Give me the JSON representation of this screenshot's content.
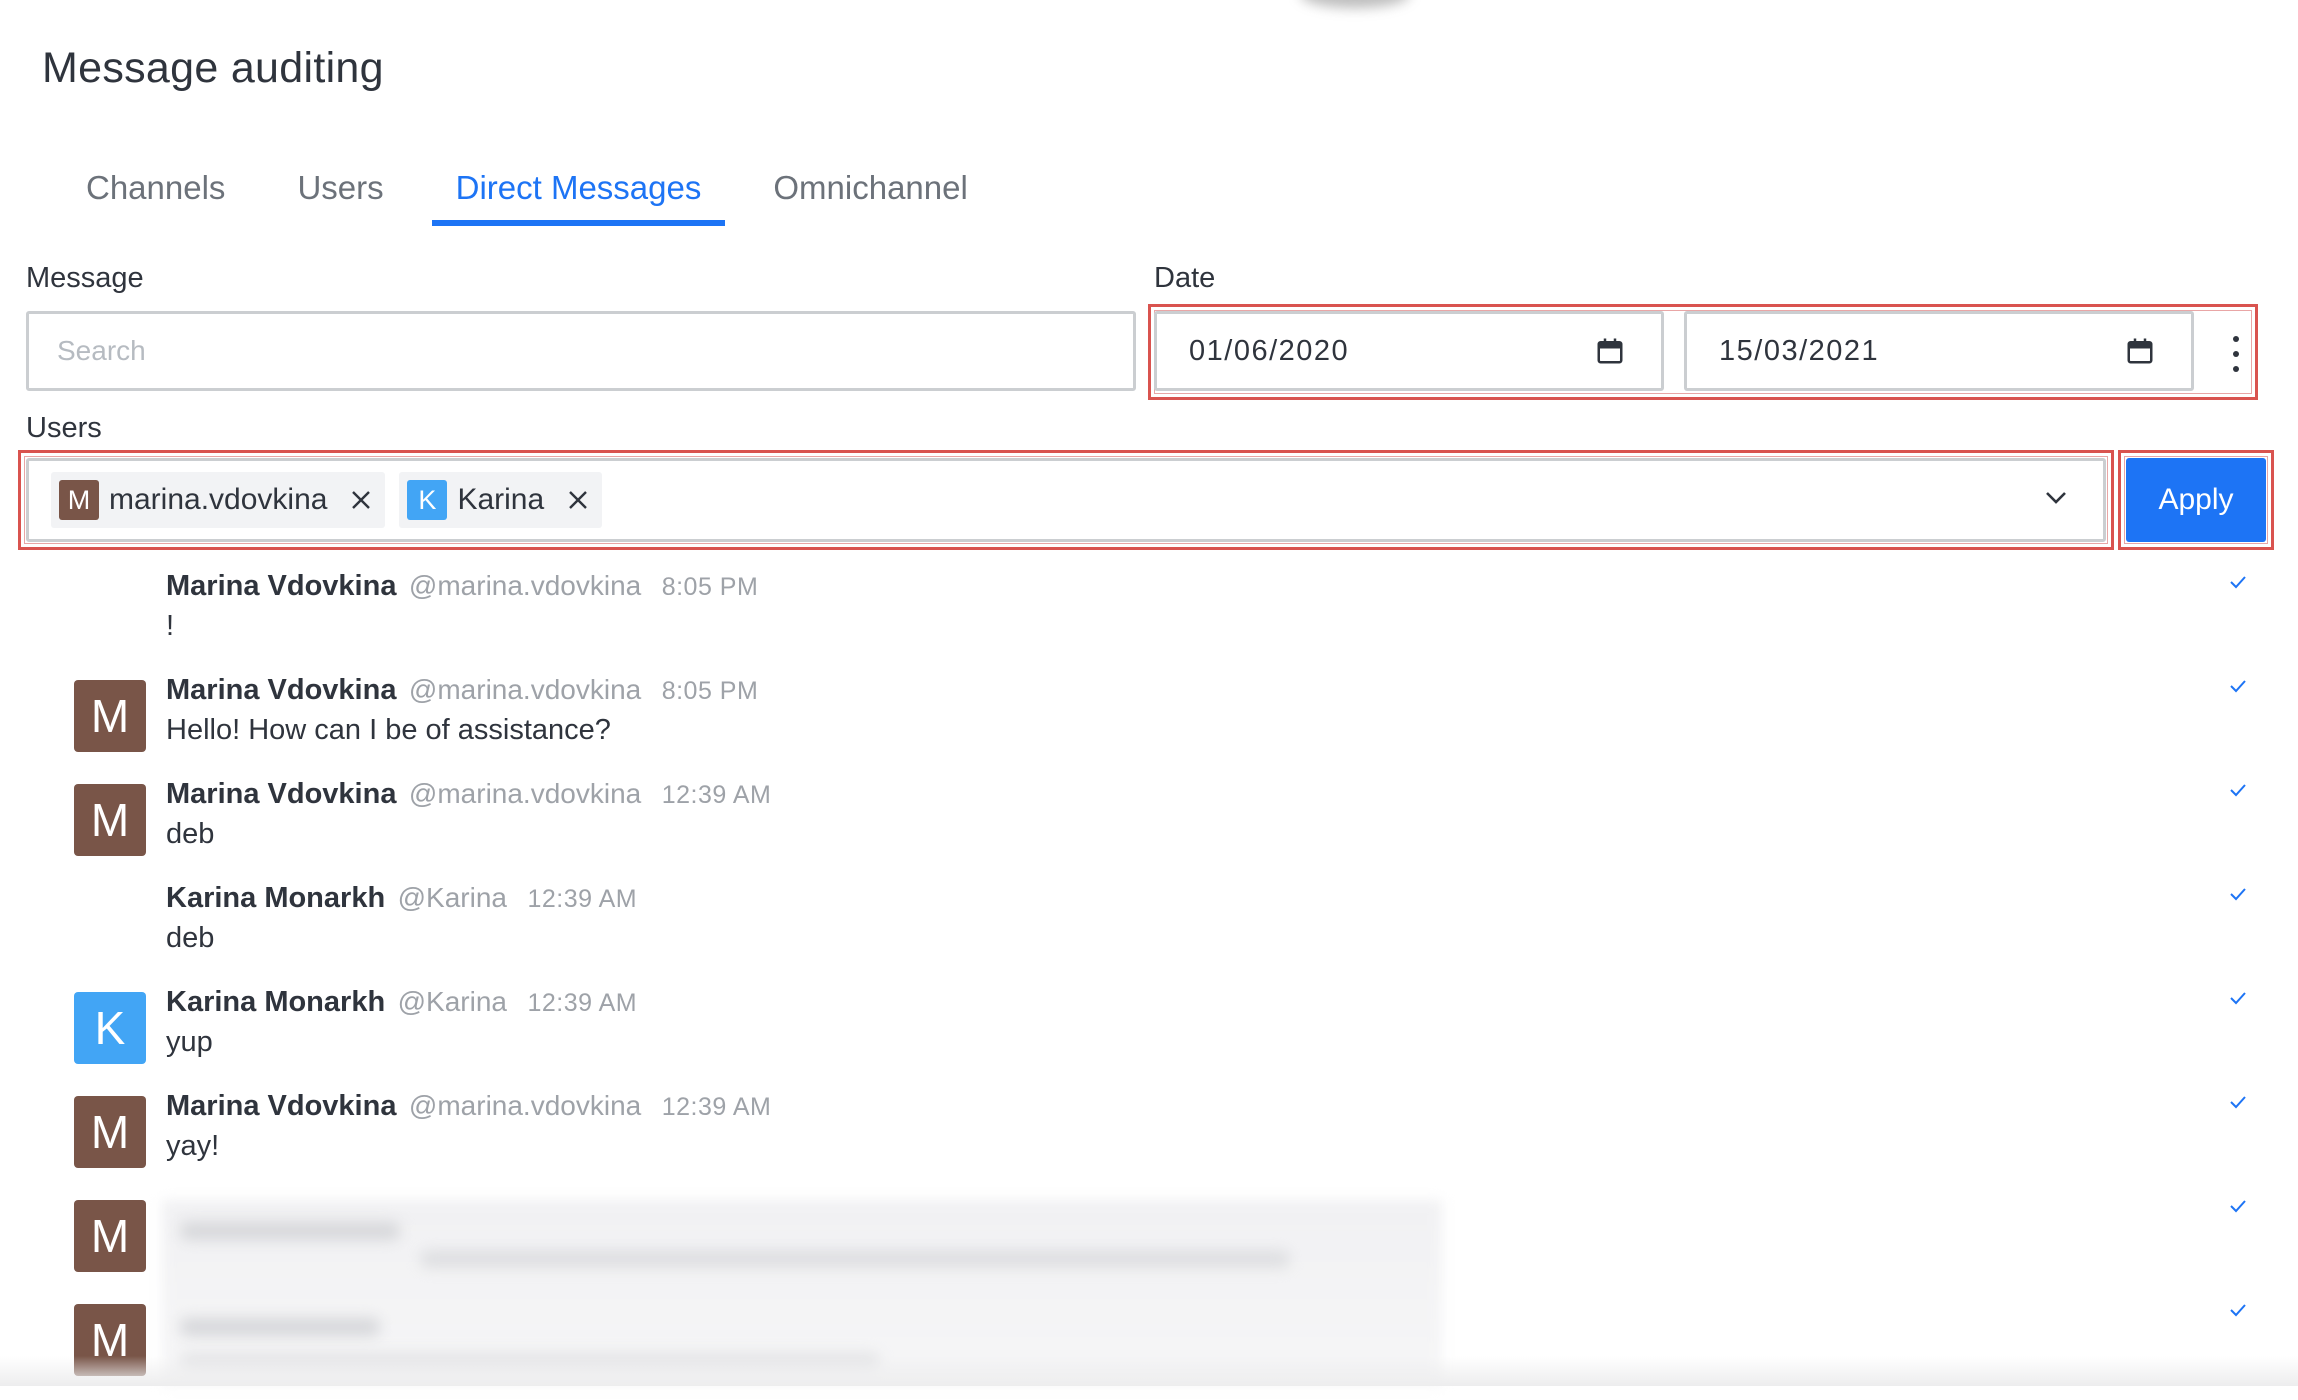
{
  "page": {
    "title": "Message auditing"
  },
  "tabs": [
    {
      "label": "Channels",
      "active": false
    },
    {
      "label": "Users",
      "active": false
    },
    {
      "label": "Direct Messages",
      "active": true
    },
    {
      "label": "Omnichannel",
      "active": false
    }
  ],
  "filters": {
    "message_label": "Message",
    "message_placeholder": "Search",
    "message_value": "",
    "date_label": "Date",
    "date_from": "01/06/2020",
    "date_to": "15/03/2021",
    "users_label": "Users",
    "selected_users": [
      {
        "initial": "M",
        "name": "marina.vdovkina",
        "color": "#795548"
      },
      {
        "initial": "K",
        "name": "Karina",
        "color": "#42a5f5"
      }
    ],
    "apply_label": "Apply"
  },
  "messages": [
    {
      "name": "Marina Vdovkina",
      "username": "@marina.vdovkina",
      "time": "8:05 PM",
      "text": "!",
      "avatar": "",
      "avatar_color": ""
    },
    {
      "name": "Marina Vdovkina",
      "username": "@marina.vdovkina",
      "time": "8:05 PM",
      "text": "Hello! How can I be of assistance?",
      "avatar": "M",
      "avatar_color": "#795548"
    },
    {
      "name": "Marina Vdovkina",
      "username": "@marina.vdovkina",
      "time": "12:39 AM",
      "text": "deb",
      "avatar": "M",
      "avatar_color": "#795548"
    },
    {
      "name": "Karina Monarkh",
      "username": "@Karina",
      "time": "12:39 AM",
      "text": "deb",
      "avatar": "",
      "avatar_color": ""
    },
    {
      "name": "Karina Monarkh",
      "username": "@Karina",
      "time": "12:39 AM",
      "text": "yup",
      "avatar": "K",
      "avatar_color": "#42a5f5"
    },
    {
      "name": "Marina Vdovkina",
      "username": "@marina.vdovkina",
      "time": "12:39 AM",
      "text": "yay!",
      "avatar": "M",
      "avatar_color": "#795548"
    }
  ],
  "blurred_messages": [
    {
      "avatar": "M",
      "avatar_color": "#795548"
    },
    {
      "avatar": "M",
      "avatar_color": "#795548"
    }
  ],
  "colors": {
    "accent": "#1d74f5",
    "highlight": "#d9534f"
  },
  "icons": {
    "date": "calendar-icon",
    "more": "kebab-menu-icon",
    "remove": "close-icon",
    "dropdown": "chevron-down-icon",
    "read": "check-icon"
  }
}
